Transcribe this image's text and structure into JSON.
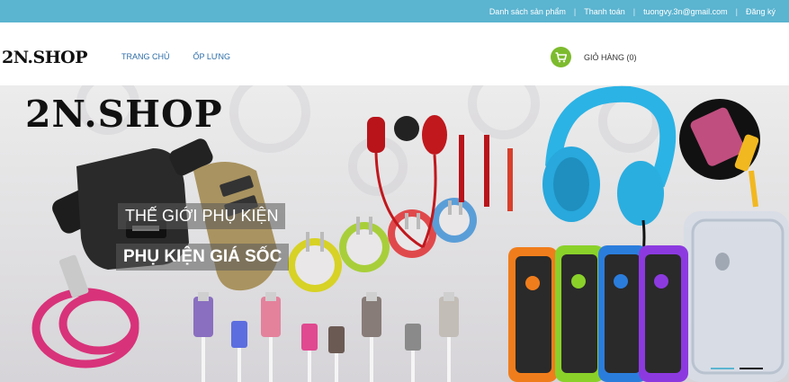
{
  "topbar": {
    "links": [
      {
        "label": "Danh sách sản phẩm"
      },
      {
        "label": "Thanh toán"
      },
      {
        "label": "tuongvy.3n@gmail.com"
      },
      {
        "label": "Đăng ký"
      }
    ]
  },
  "header": {
    "logo": "2N.SHOP",
    "nav": [
      {
        "label": "TRANG CHỦ"
      },
      {
        "label": "ỐP LƯNG"
      }
    ],
    "cart_icon": "shopping-cart-icon",
    "cart_label": "GIỎ HÀNG (0)"
  },
  "banner": {
    "logo_text": "2N.SHOP",
    "caption_1": "THẾ GIỚI PHỤ KIỆN",
    "caption_2": "PHỤ KIỆN GIÁ SỐC",
    "slide_count": 2,
    "active_slide": 2
  },
  "colors": {
    "topbar": "#5bb4d0",
    "cart": "#7dbb2e",
    "nav": "#2d6ea8"
  }
}
